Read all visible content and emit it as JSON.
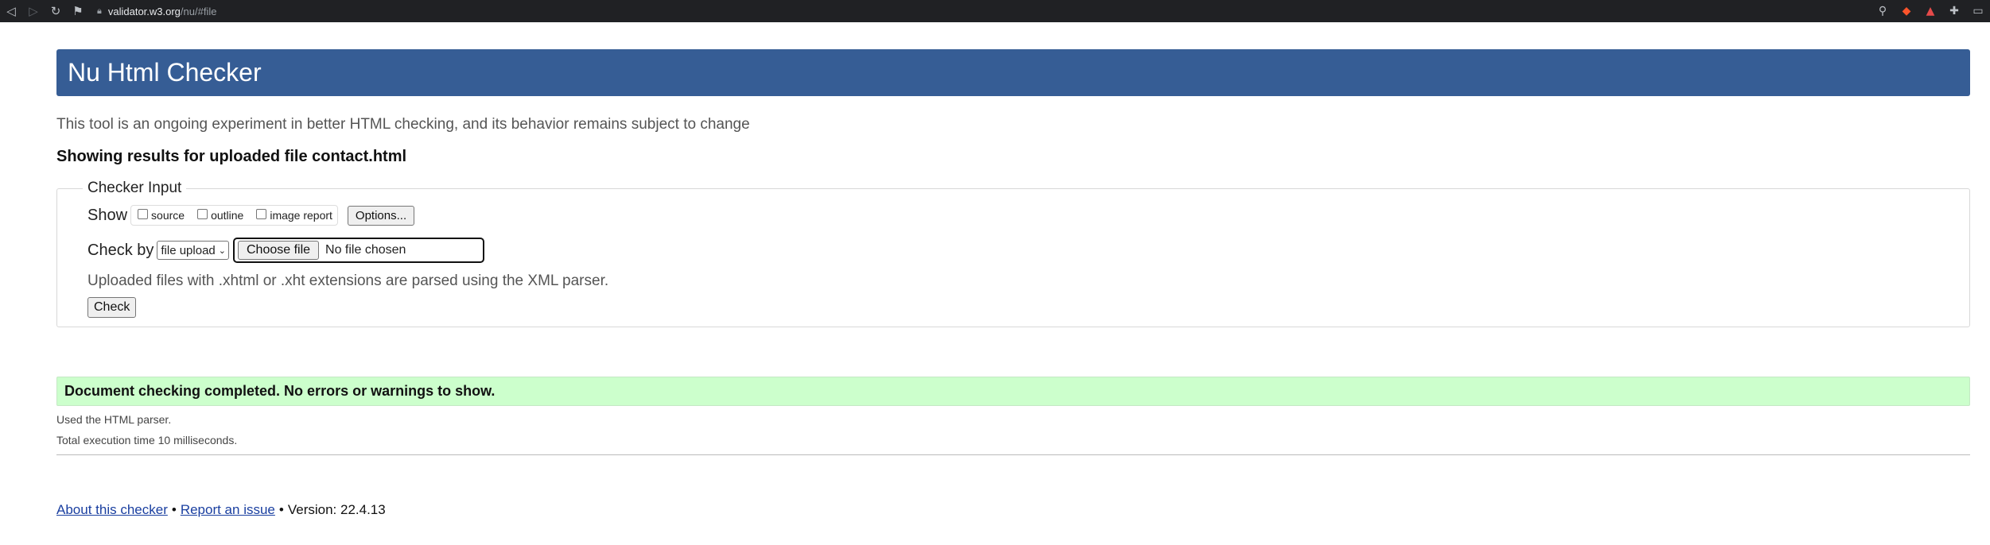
{
  "browser": {
    "url_host": "validator.w3.org",
    "url_path": "/nu/#file",
    "icons": [
      "back-icon",
      "forward-icon",
      "reload-icon",
      "bookmark-icon",
      "zoom-icon",
      "brave-shield-icon",
      "brave-rewards-icon",
      "extensions-icon"
    ]
  },
  "header": {
    "title": "Nu Html Checker"
  },
  "intro": "This tool is an ongoing experiment in better HTML checking, and its behavior remains subject to change",
  "results_for": "Showing results for uploaded file contact.html",
  "checker": {
    "legend": "Checker Input",
    "show_label": "Show",
    "options": [
      {
        "label": "source",
        "checked": false
      },
      {
        "label": "outline",
        "checked": false
      },
      {
        "label": "image report",
        "checked": false
      }
    ],
    "options_button": "Options...",
    "check_by_label": "Check by",
    "check_by_value": "file upload",
    "choose_file_button": "Choose file",
    "no_file_text": "No file chosen",
    "note": "Uploaded files with .xhtml or .xht extensions are parsed using the XML parser.",
    "check_button": "Check"
  },
  "result": {
    "success_message": "Document checking completed. No errors or warnings to show.",
    "parser_note": "Used the HTML parser.",
    "execution_time": "Total execution time 10 milliseconds."
  },
  "footer": {
    "about_link": "About this checker",
    "separator": "•",
    "report_link": "Report an issue",
    "version": "Version: 22.4.13"
  },
  "colors": {
    "header_bg": "#365d95",
    "success_bg": "#ccffcc",
    "link": "#1a3fa0"
  }
}
